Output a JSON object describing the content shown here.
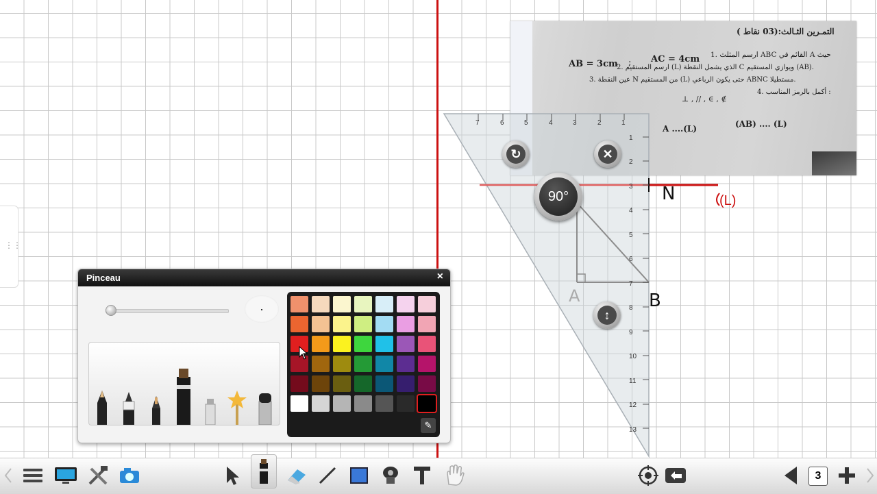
{
  "window": {
    "title": "Pinceau"
  },
  "panel": {
    "close_glyph": "×",
    "dropper_glyph": "✎"
  },
  "photo": {
    "title": "التمـرين الثـالث:(03 نقاط )",
    "line1": "1. ارسم المثلث ABC القائم في A حيث",
    "ac": "AC = 4cm",
    "sep": ";",
    "ab": "AB = 3cm",
    "line2": "2. ارسم المستقيم (L) الذي يشمل النقطة C ويوازي المستقيم (AB).",
    "line3": "3. عين النقطة N من المستقيم (L) حتى يكون الرباعي ABNC مستطيلا.",
    "line4": "4. أكمل بالرمز المناسب :",
    "symbols": "⊥ , // , ∈ , ∉",
    "fill1": "A ....(L)",
    "fill2": "(AB) .... (L)"
  },
  "set_square": {
    "angle_label": "90°",
    "top_scale": [
      "7",
      "6",
      "5",
      "4",
      "3",
      "2",
      "1"
    ],
    "side_scale": [
      "1",
      "2",
      "3",
      "4",
      "5",
      "6",
      "7",
      "8",
      "9",
      "10",
      "11",
      "12",
      "13"
    ],
    "rotate_glyph": "↻",
    "close_glyph": "✕",
    "move_glyph": "↕"
  },
  "drawing": {
    "label_n": "N",
    "label_l": "(L)",
    "label_a": "A",
    "label_b": "B"
  },
  "palette": {
    "selected": "#000000",
    "rows": [
      [
        "#f0916c",
        "#f5d9bd",
        "#fbf6cf",
        "#e8f5bf",
        "#d8eef8",
        "#f5d3ee",
        "#f6cfdb"
      ],
      [
        "#eb6530",
        "#f3c293",
        "#fbf38c",
        "#cfee82",
        "#a3dcf3",
        "#ea9ee3",
        "#f1a5b4"
      ],
      [
        "#e01f1f",
        "#f39a1a",
        "#fbf21f",
        "#3ed63e",
        "#20c1e8",
        "#9b57b7",
        "#e95378"
      ],
      [
        "#a61527",
        "#a0660e",
        "#9e8b0f",
        "#249a36",
        "#1187a7",
        "#5c2d91",
        "#b5146a"
      ],
      [
        "#740b1c",
        "#6d440a",
        "#6a5e10",
        "#15672a",
        "#0b5776",
        "#361e6e",
        "#780b46"
      ],
      [
        "#ffffff",
        "#d5d5d5",
        "#b5b5b5",
        "#8a8a8a",
        "#555555",
        "#2a2a2a",
        "#000000"
      ]
    ]
  },
  "taskbar": {
    "page_number": "3",
    "icons": [
      "menu-icon",
      "monitor-icon",
      "tools-icon",
      "camera-icon",
      "pointer-icon",
      "pen-icon",
      "eraser-icon",
      "line-icon",
      "shape-icon",
      "stamp-icon",
      "text-icon",
      "hand-icon",
      "target-icon",
      "undo-icon",
      "prev-page-icon",
      "page-number",
      "add-page-icon"
    ]
  }
}
